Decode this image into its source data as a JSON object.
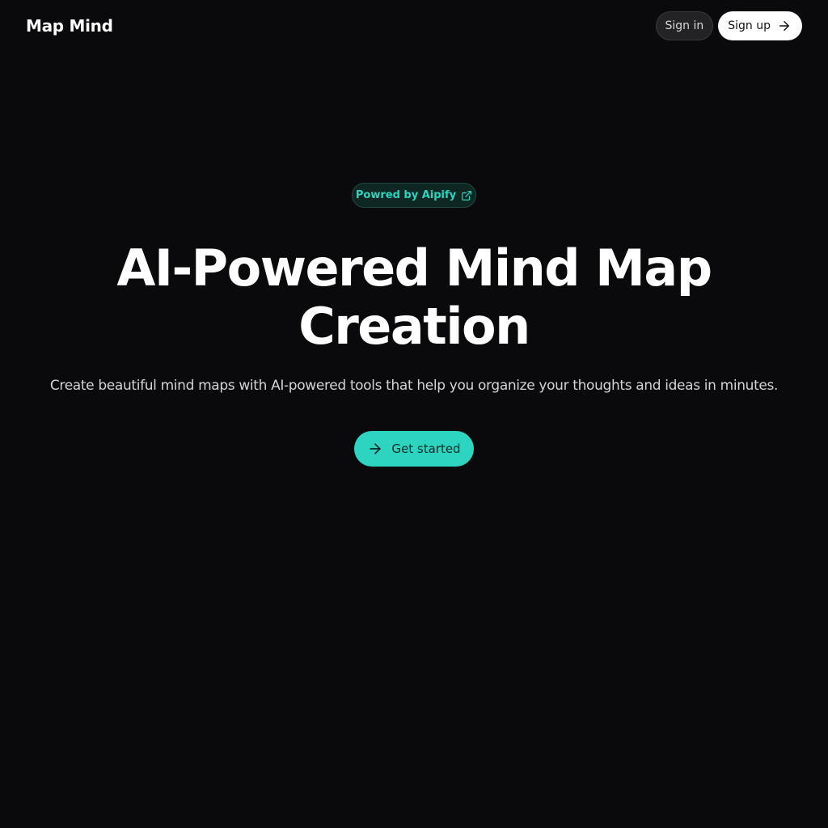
{
  "header": {
    "logo": "Map Mind",
    "sign_in_label": "Sign in",
    "sign_up_label": "Sign up",
    "sign_up_icon": "arrow-right-icon"
  },
  "hero": {
    "badge_label": "Powred by Aipify",
    "badge_icon": "external-link-icon",
    "title_line1": "AI-Powered Mind Map",
    "title_line2": "Creation",
    "subtitle": "Create beautiful mind maps with AI-powered tools that help you organize your thoughts and ideas in minutes.",
    "cta_label": "Get started",
    "cta_icon": "arrow-right-icon"
  },
  "colors": {
    "background": "#0a0a0c",
    "accent": "#2dd4bf",
    "text": "#ffffff"
  }
}
